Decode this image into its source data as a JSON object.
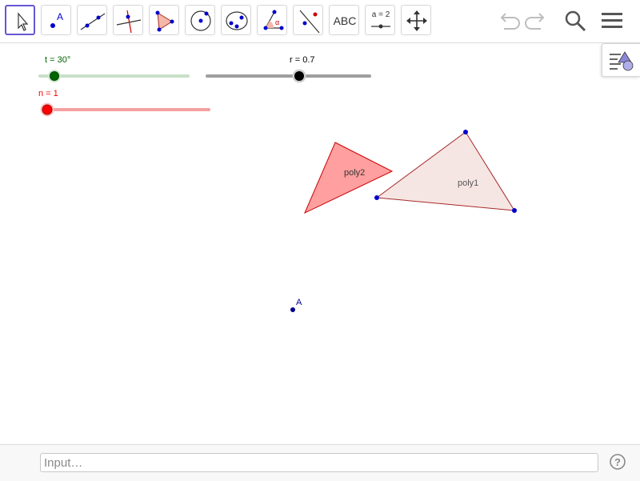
{
  "toolbar": {
    "tools": [
      {
        "name": "move-tool",
        "active": true
      },
      {
        "name": "point-tool",
        "icon_letter": "A"
      },
      {
        "name": "line-tool"
      },
      {
        "name": "perpendicular-line-tool"
      },
      {
        "name": "polygon-tool"
      },
      {
        "name": "circle-tool"
      },
      {
        "name": "conic-tool"
      },
      {
        "name": "angle-tool",
        "icon_symbol": "α"
      },
      {
        "name": "reflect-tool"
      },
      {
        "name": "text-tool",
        "label": "ABC"
      },
      {
        "name": "slider-tool",
        "label": "a = 2"
      },
      {
        "name": "move-graphics-view-tool"
      }
    ],
    "right": [
      "undo-icon",
      "redo-icon",
      "search-icon",
      "menu-icon"
    ]
  },
  "sliders": {
    "t": {
      "label": "t = 30°",
      "value_deg": 30,
      "min_deg": 0,
      "max_deg": 360,
      "color": "#006400"
    },
    "r": {
      "label": "r = 0.7",
      "value": 0.7,
      "color": "#000000"
    },
    "n": {
      "label": "n = 1",
      "value": 1,
      "color": "#ff0000"
    }
  },
  "graphics": {
    "poly1": {
      "label": "poly1",
      "fill": "#f6e6e3",
      "stroke": "#a52a2a"
    },
    "poly2": {
      "label": "poly2",
      "fill": "#ff9a9a",
      "stroke": "#cc0000"
    },
    "point_A": {
      "label": "A",
      "color": "#00008b"
    }
  },
  "input_bar": {
    "placeholder": "Input…"
  },
  "colors": {
    "accent": "#6557d2",
    "point": "#0000cc"
  }
}
